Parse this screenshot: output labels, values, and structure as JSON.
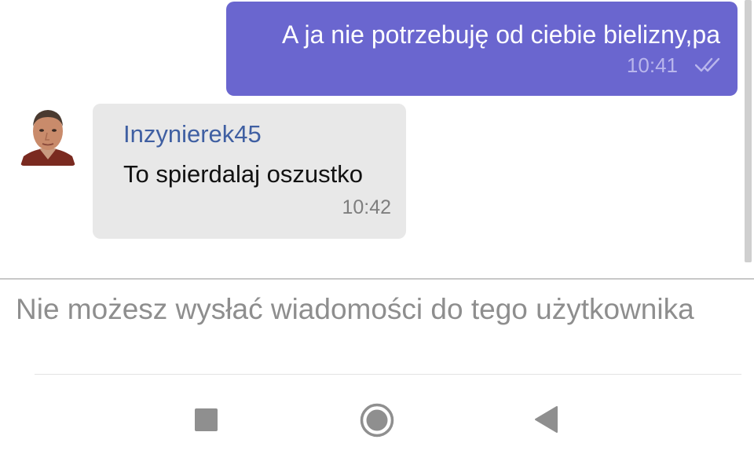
{
  "chat": {
    "outgoing": {
      "text": "A ja nie potrzebuję od ciebie bielizny,pa",
      "time": "10:41",
      "status_icon": "double-check-icon",
      "bubble_color": "#6a66cf"
    },
    "incoming": {
      "sender": "Inzynierek45",
      "text": "To spierdalaj oszustko",
      "time": "10:42",
      "sender_color": "#3f5fa2",
      "bubble_color": "#e8e8e8"
    }
  },
  "composer": {
    "notice": "Nie możesz wysłać wiadomości do tego użytkownika"
  },
  "navbar": {
    "icons": [
      "recent-apps-icon",
      "home-icon",
      "back-icon"
    ]
  }
}
